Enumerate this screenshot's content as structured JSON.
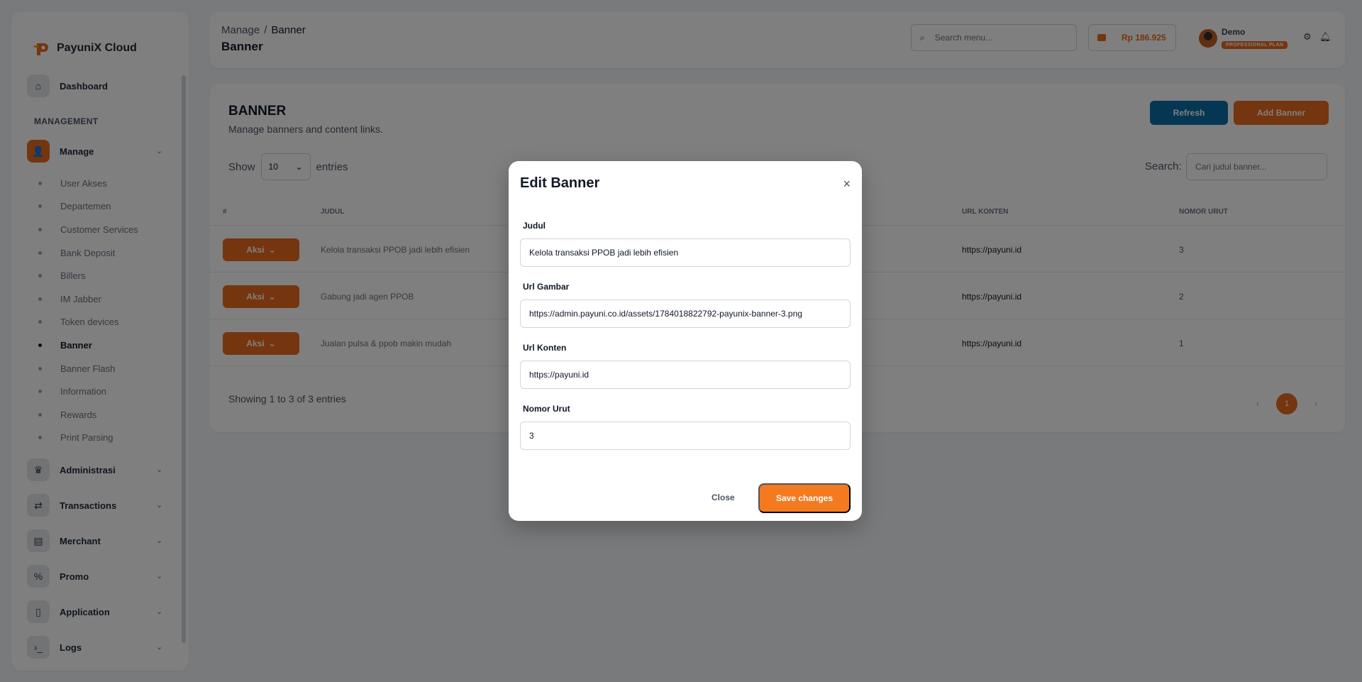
{
  "brand": {
    "name": "PayuniX Cloud"
  },
  "sidebar": {
    "dashboard": "Dashboard",
    "section": "MANAGEMENT",
    "manage": "Manage",
    "manage_items": [
      "User Akses",
      "Departemen",
      "Customer Services",
      "Bank Deposit",
      "Billers",
      "IM Jabber",
      "Token devices",
      "Banner",
      "Banner Flash",
      "Information",
      "Rewards",
      "Print Parsing"
    ],
    "active_item": "Banner",
    "groups": [
      "Administrasi",
      "Transactions",
      "Merchant",
      "Promo",
      "Application",
      "Logs"
    ]
  },
  "header": {
    "breadcrumb_parent": "Manage",
    "breadcrumb_sep": "/",
    "breadcrumb_current": "Banner",
    "title": "Banner",
    "search_placeholder": "Search menu...",
    "balance": "Rp 186.925",
    "user_name": "Demo",
    "plan": "PROFESSIONAL PLAN"
  },
  "card": {
    "title": "BANNER",
    "subtitle": "Manage banners and content links.",
    "refresh": "Refresh",
    "add": "Add Banner",
    "show_label": "Show",
    "show_value": "10",
    "entries_label": "entries",
    "search_label": "Search:",
    "search_placeholder": "Cari judul banner...",
    "columns": {
      "no": "#",
      "judul": "JUDUL",
      "url": "URL KONTEN",
      "nomor": "NOMOR URUT"
    },
    "rows": [
      {
        "action": "Aksi",
        "judul": "Kelola transaksi PPOB jadi lebih efisien",
        "url": "https://payuni.id",
        "nomor": "3"
      },
      {
        "action": "Aksi",
        "judul": "Gabung jadi agen PPOB",
        "url": "https://payuni.id",
        "nomor": "2"
      },
      {
        "action": "Aksi",
        "judul": "Jualan pulsa & ppob makin mudah",
        "url": "https://payuni.id",
        "nomor": "1"
      }
    ],
    "footer": "Showing 1 to 3 of 3 entries",
    "page": "1"
  },
  "modal": {
    "title": "Edit Banner",
    "judul_label": "Judul",
    "judul_value": "Kelola transaksi PPOB jadi lebih efisien",
    "gambar_label": "Url Gambar",
    "gambar_value": "https://admin.payuni.co.id/assets/1784018822792-payunix-banner-3.png",
    "konten_label": "Url Konten",
    "konten_value": "https://payuni.id",
    "urut_label": "Nomor Urut",
    "urut_value": "3",
    "close": "Close",
    "save": "Save changes"
  },
  "colors": {
    "accent": "#ea6a1f",
    "refresh": "#0b6ea8"
  }
}
